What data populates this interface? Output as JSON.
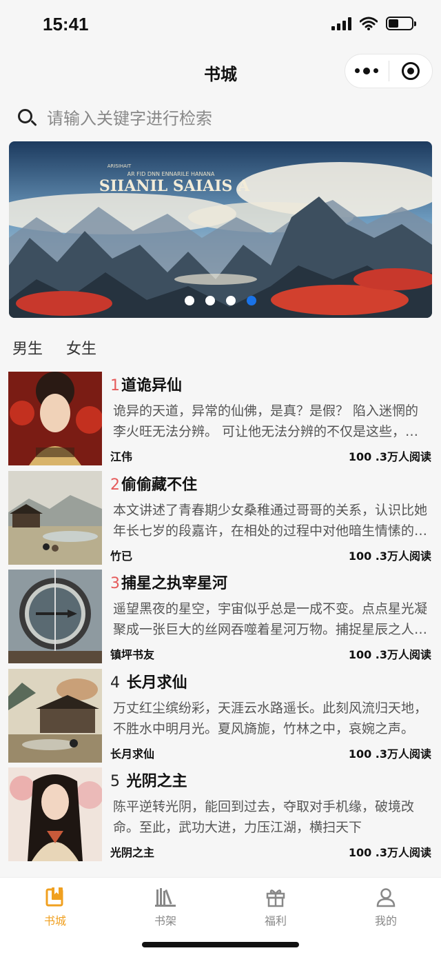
{
  "status": {
    "time": "15:41"
  },
  "nav": {
    "title": "书城"
  },
  "search": {
    "placeholder": "请输入关键字进行检索"
  },
  "banner": {
    "text_big": "SIIANIL SAIAIS A",
    "text_small": "AR FID DNN ENNARILE HANANA",
    "slides": 4,
    "active_slide": 4
  },
  "tabs": [
    "男生",
    "女生"
  ],
  "books": [
    {
      "rank": "1",
      "title": "道诡异仙",
      "desc": "诡异的天道，异常的仙佛，是真？是假？ 陷入迷惘的李火旺无法分辨。 可让他无法分辨的不仅是这些，还有他自己，他不知道自己到底是生活在高武世界的大能，还是个深陷虚幻的精神病患者。",
      "author": "江伟",
      "reads": "100 .3万人阅读",
      "rank_color": "red"
    },
    {
      "rank": "2",
      "title": "偷偷藏不住",
      "desc": "本文讲述了青春期少女桑稚通过哥哥的关系，认识比她年长七岁的段嘉许，在相处的过程中对他暗生情愫的故事。",
      "author": "竹已",
      "reads": "100 .3万人阅读",
      "rank_color": "red"
    },
    {
      "rank": "3",
      "title": "捕星之执宰星河",
      "desc": "遥望黑夜的星空，宇宙似乎总是一成不变。点点星光凝聚成一张巨大的丝网吞噬着星河万物。捕捉星辰之人，执掌星河。",
      "author": "镇坪书友",
      "reads": "100 .3万人阅读",
      "rank_color": "red"
    },
    {
      "rank": "4",
      "title": "长月求仙",
      "desc": "万丈红尘缤纷彩，天涯云水路遥长。此刻风流归天地，不胜水中明月光。夏风旖旎，竹林之中，哀婉之声。",
      "author": "长月求仙",
      "reads": "100 .3万人阅读",
      "rank_color": "plain"
    },
    {
      "rank": "5",
      "title": "光阴之主",
      "desc": "陈平逆转光阴，能回到过去，夺取对手机缘，破境改命。至此，武功大进，力压江湖，横扫天下",
      "author": "光阴之主",
      "reads": "100 .3万人阅读",
      "rank_color": "plain"
    }
  ],
  "tabbar": [
    {
      "label": "书城",
      "icon": "book-icon",
      "active": true
    },
    {
      "label": "书架",
      "icon": "bookshelf-icon",
      "active": false
    },
    {
      "label": "福利",
      "icon": "gift-icon",
      "active": false
    },
    {
      "label": "我的",
      "icon": "user-icon",
      "active": false
    }
  ],
  "colors": {
    "accent": "#f0a020",
    "rank_red": "#e55a5a",
    "dot_active": "#1a73e8"
  }
}
